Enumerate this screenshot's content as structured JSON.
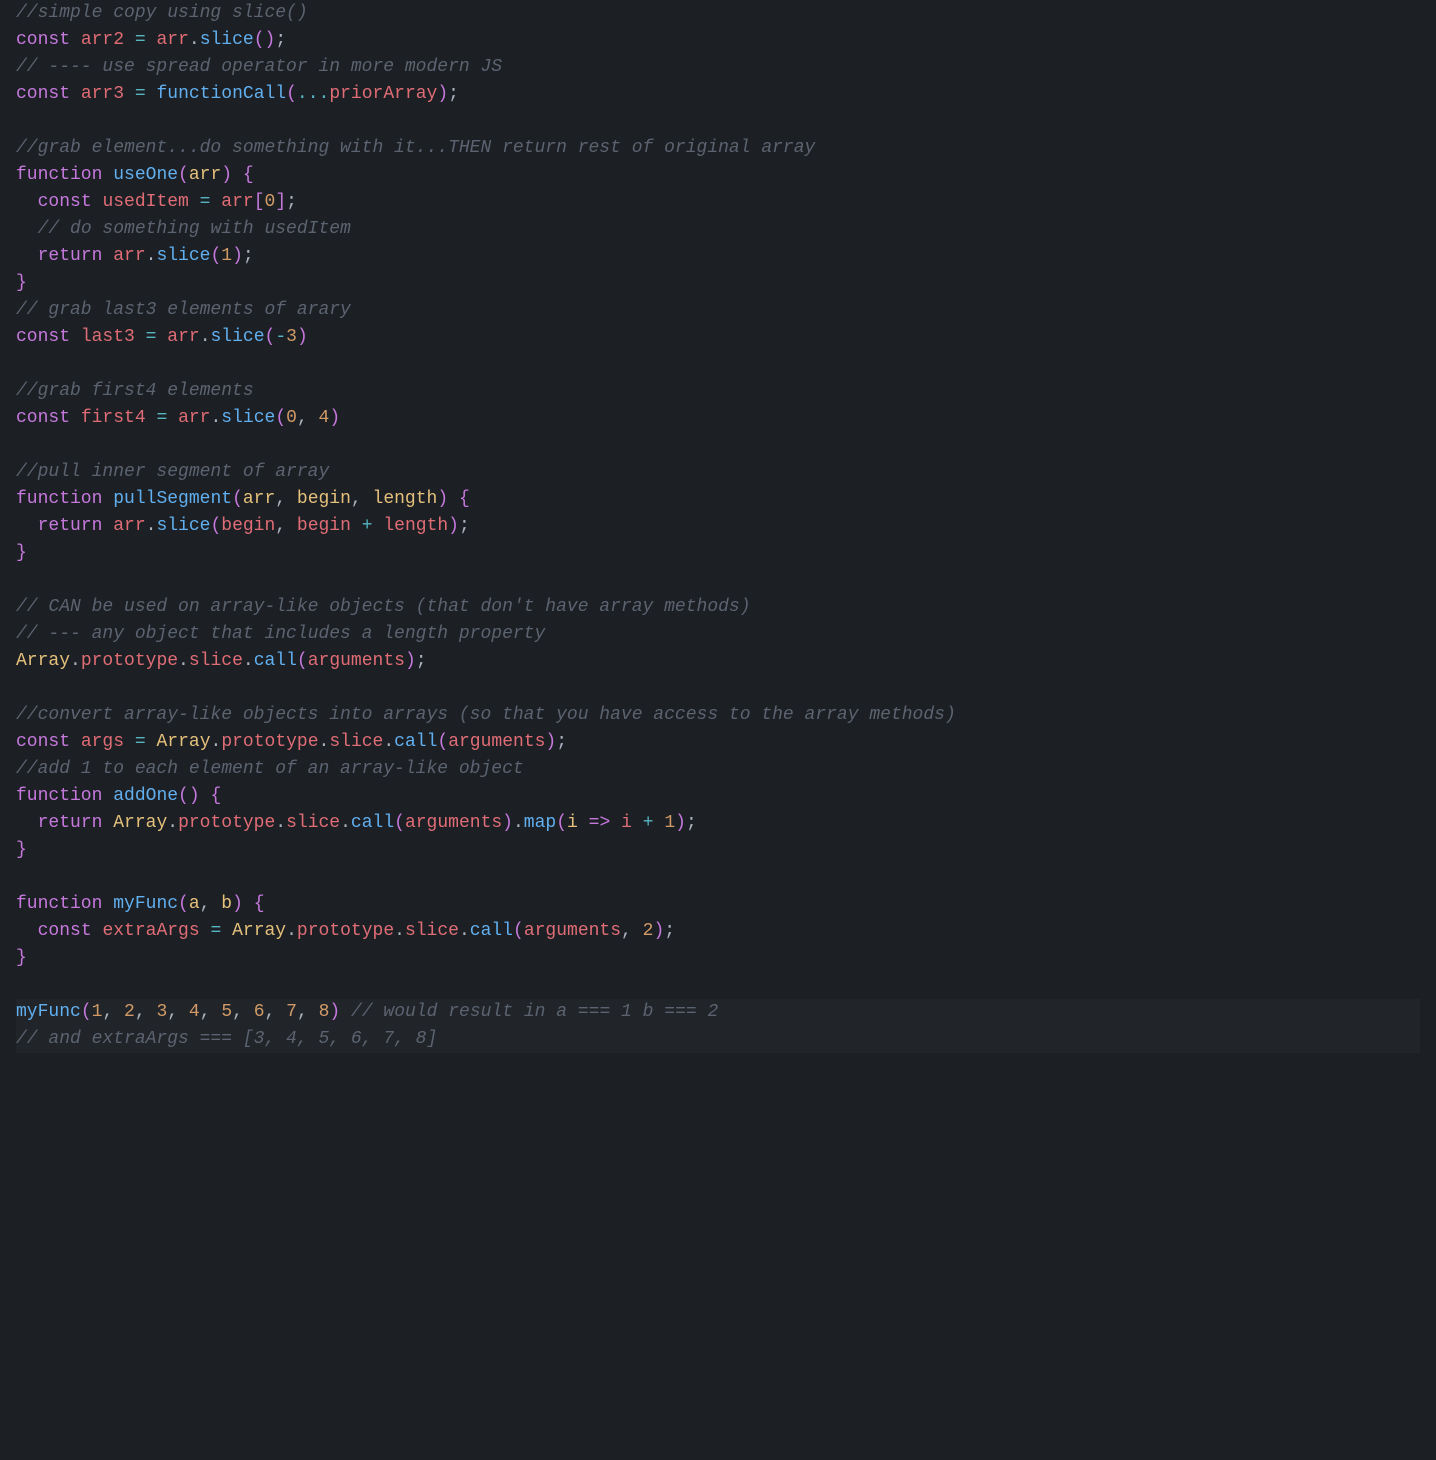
{
  "theme": {
    "bg": "#1c2025",
    "fg": "#abb2bf",
    "comment": "#5c6370",
    "keyword": "#c678dd",
    "varname": "#e06c75",
    "funcname": "#61afef",
    "param": "#e5c07b",
    "op": "#56b6c2",
    "num": "#d19a66",
    "builtin": "#e5c07b"
  },
  "language": "javascript",
  "lines": [
    {
      "n": 1,
      "hl": false,
      "tokens": [
        {
          "c": "comment",
          "t": "//simple copy using slice()"
        }
      ]
    },
    {
      "n": 2,
      "hl": false,
      "tokens": [
        {
          "c": "storage",
          "t": "const"
        },
        {
          "c": "plain",
          "t": " "
        },
        {
          "c": "varname",
          "t": "arr2"
        },
        {
          "c": "plain",
          "t": " "
        },
        {
          "c": "op",
          "t": "="
        },
        {
          "c": "plain",
          "t": " "
        },
        {
          "c": "varname",
          "t": "arr"
        },
        {
          "c": "punct",
          "t": "."
        },
        {
          "c": "funccall",
          "t": "slice"
        },
        {
          "c": "paren",
          "t": "()"
        },
        {
          "c": "punct",
          "t": ";"
        }
      ]
    },
    {
      "n": 3,
      "hl": false,
      "tokens": [
        {
          "c": "comment",
          "t": "// ---- use spread operator in more modern JS"
        }
      ]
    },
    {
      "n": 4,
      "hl": false,
      "tokens": [
        {
          "c": "storage",
          "t": "const"
        },
        {
          "c": "plain",
          "t": " "
        },
        {
          "c": "varname",
          "t": "arr3"
        },
        {
          "c": "plain",
          "t": " "
        },
        {
          "c": "op",
          "t": "="
        },
        {
          "c": "plain",
          "t": " "
        },
        {
          "c": "funccall",
          "t": "functionCall"
        },
        {
          "c": "paren",
          "t": "("
        },
        {
          "c": "op",
          "t": "..."
        },
        {
          "c": "varname",
          "t": "priorArray"
        },
        {
          "c": "paren",
          "t": ")"
        },
        {
          "c": "punct",
          "t": ";"
        }
      ]
    },
    {
      "n": 5,
      "hl": false,
      "tokens": []
    },
    {
      "n": 6,
      "hl": false,
      "tokens": [
        {
          "c": "comment",
          "t": "//grab element...do something with it...THEN return rest of original array"
        }
      ]
    },
    {
      "n": 7,
      "hl": false,
      "tokens": [
        {
          "c": "storage",
          "t": "function"
        },
        {
          "c": "plain",
          "t": " "
        },
        {
          "c": "funcname",
          "t": "useOne"
        },
        {
          "c": "paren",
          "t": "("
        },
        {
          "c": "param",
          "t": "arr"
        },
        {
          "c": "paren",
          "t": ")"
        },
        {
          "c": "plain",
          "t": " "
        },
        {
          "c": "brace",
          "t": "{"
        }
      ]
    },
    {
      "n": 8,
      "hl": false,
      "tokens": [
        {
          "c": "indentguide",
          "t": "  "
        },
        {
          "c": "storage",
          "t": "const"
        },
        {
          "c": "plain",
          "t": " "
        },
        {
          "c": "varname",
          "t": "usedItem"
        },
        {
          "c": "plain",
          "t": " "
        },
        {
          "c": "op",
          "t": "="
        },
        {
          "c": "plain",
          "t": " "
        },
        {
          "c": "varname",
          "t": "arr"
        },
        {
          "c": "bracket",
          "t": "["
        },
        {
          "c": "num",
          "t": "0"
        },
        {
          "c": "bracket",
          "t": "]"
        },
        {
          "c": "punct",
          "t": ";"
        }
      ]
    },
    {
      "n": 9,
      "hl": false,
      "tokens": [
        {
          "c": "indentguide",
          "t": "  "
        },
        {
          "c": "comment",
          "t": "// do something with usedItem"
        }
      ]
    },
    {
      "n": 10,
      "hl": false,
      "tokens": [
        {
          "c": "indentguide",
          "t": "  "
        },
        {
          "c": "storage",
          "t": "return"
        },
        {
          "c": "plain",
          "t": " "
        },
        {
          "c": "varname",
          "t": "arr"
        },
        {
          "c": "punct",
          "t": "."
        },
        {
          "c": "funccall",
          "t": "slice"
        },
        {
          "c": "paren",
          "t": "("
        },
        {
          "c": "num",
          "t": "1"
        },
        {
          "c": "paren",
          "t": ")"
        },
        {
          "c": "punct",
          "t": ";"
        }
      ]
    },
    {
      "n": 11,
      "hl": false,
      "tokens": [
        {
          "c": "brace",
          "t": "}"
        }
      ]
    },
    {
      "n": 12,
      "hl": false,
      "tokens": [
        {
          "c": "comment",
          "t": "// grab last3 elements of arary"
        }
      ]
    },
    {
      "n": 13,
      "hl": false,
      "tokens": [
        {
          "c": "storage",
          "t": "const"
        },
        {
          "c": "plain",
          "t": " "
        },
        {
          "c": "varname",
          "t": "last3"
        },
        {
          "c": "plain",
          "t": " "
        },
        {
          "c": "op",
          "t": "="
        },
        {
          "c": "plain",
          "t": " "
        },
        {
          "c": "varname",
          "t": "arr"
        },
        {
          "c": "punct",
          "t": "."
        },
        {
          "c": "funccall",
          "t": "slice"
        },
        {
          "c": "paren",
          "t": "("
        },
        {
          "c": "op",
          "t": "-"
        },
        {
          "c": "num",
          "t": "3"
        },
        {
          "c": "paren",
          "t": ")"
        }
      ]
    },
    {
      "n": 14,
      "hl": false,
      "tokens": []
    },
    {
      "n": 15,
      "hl": false,
      "tokens": [
        {
          "c": "comment",
          "t": "//grab first4 elements"
        }
      ]
    },
    {
      "n": 16,
      "hl": false,
      "tokens": [
        {
          "c": "storage",
          "t": "const"
        },
        {
          "c": "plain",
          "t": " "
        },
        {
          "c": "varname",
          "t": "first4"
        },
        {
          "c": "plain",
          "t": " "
        },
        {
          "c": "op",
          "t": "="
        },
        {
          "c": "plain",
          "t": " "
        },
        {
          "c": "varname",
          "t": "arr"
        },
        {
          "c": "punct",
          "t": "."
        },
        {
          "c": "funccall",
          "t": "slice"
        },
        {
          "c": "paren",
          "t": "("
        },
        {
          "c": "num",
          "t": "0"
        },
        {
          "c": "punct",
          "t": ", "
        },
        {
          "c": "num",
          "t": "4"
        },
        {
          "c": "paren",
          "t": ")"
        }
      ]
    },
    {
      "n": 17,
      "hl": false,
      "tokens": []
    },
    {
      "n": 18,
      "hl": false,
      "tokens": [
        {
          "c": "comment",
          "t": "//pull inner segment of array"
        }
      ]
    },
    {
      "n": 19,
      "hl": false,
      "tokens": [
        {
          "c": "storage",
          "t": "function"
        },
        {
          "c": "plain",
          "t": " "
        },
        {
          "c": "funcname",
          "t": "pullSegment"
        },
        {
          "c": "paren",
          "t": "("
        },
        {
          "c": "param",
          "t": "arr"
        },
        {
          "c": "punct",
          "t": ", "
        },
        {
          "c": "param",
          "t": "begin"
        },
        {
          "c": "punct",
          "t": ", "
        },
        {
          "c": "param",
          "t": "length"
        },
        {
          "c": "paren",
          "t": ")"
        },
        {
          "c": "plain",
          "t": " "
        },
        {
          "c": "brace",
          "t": "{"
        }
      ]
    },
    {
      "n": 20,
      "hl": false,
      "tokens": [
        {
          "c": "indentguide",
          "t": "  "
        },
        {
          "c": "storage",
          "t": "return"
        },
        {
          "c": "plain",
          "t": " "
        },
        {
          "c": "varname",
          "t": "arr"
        },
        {
          "c": "punct",
          "t": "."
        },
        {
          "c": "funccall",
          "t": "slice"
        },
        {
          "c": "paren",
          "t": "("
        },
        {
          "c": "varname",
          "t": "begin"
        },
        {
          "c": "punct",
          "t": ", "
        },
        {
          "c": "varname",
          "t": "begin"
        },
        {
          "c": "plain",
          "t": " "
        },
        {
          "c": "op",
          "t": "+"
        },
        {
          "c": "plain",
          "t": " "
        },
        {
          "c": "varname",
          "t": "length"
        },
        {
          "c": "paren",
          "t": ")"
        },
        {
          "c": "punct",
          "t": ";"
        }
      ]
    },
    {
      "n": 21,
      "hl": false,
      "tokens": [
        {
          "c": "brace",
          "t": "}"
        }
      ]
    },
    {
      "n": 22,
      "hl": false,
      "tokens": []
    },
    {
      "n": 23,
      "hl": false,
      "tokens": [
        {
          "c": "comment",
          "t": "// CAN be used on array-like objects (that don't have array methods)"
        }
      ]
    },
    {
      "n": 24,
      "hl": false,
      "tokens": [
        {
          "c": "comment",
          "t": "// --- any object that includes a length property"
        }
      ]
    },
    {
      "n": 25,
      "hl": false,
      "tokens": [
        {
          "c": "builtin",
          "t": "Array"
        },
        {
          "c": "punct",
          "t": "."
        },
        {
          "c": "prop",
          "t": "prototype"
        },
        {
          "c": "punct",
          "t": "."
        },
        {
          "c": "prop",
          "t": "slice"
        },
        {
          "c": "punct",
          "t": "."
        },
        {
          "c": "funccall",
          "t": "call"
        },
        {
          "c": "paren",
          "t": "("
        },
        {
          "c": "varname",
          "t": "arguments"
        },
        {
          "c": "paren",
          "t": ")"
        },
        {
          "c": "punct",
          "t": ";"
        }
      ]
    },
    {
      "n": 26,
      "hl": false,
      "tokens": []
    },
    {
      "n": 27,
      "hl": false,
      "tokens": [
        {
          "c": "comment",
          "t": "//convert array-like objects into arrays (so that you have access to the array methods)"
        }
      ]
    },
    {
      "n": 28,
      "hl": false,
      "tokens": [
        {
          "c": "storage",
          "t": "const"
        },
        {
          "c": "plain",
          "t": " "
        },
        {
          "c": "varname",
          "t": "args"
        },
        {
          "c": "plain",
          "t": " "
        },
        {
          "c": "op",
          "t": "="
        },
        {
          "c": "plain",
          "t": " "
        },
        {
          "c": "builtin",
          "t": "Array"
        },
        {
          "c": "punct",
          "t": "."
        },
        {
          "c": "prop",
          "t": "prototype"
        },
        {
          "c": "punct",
          "t": "."
        },
        {
          "c": "prop",
          "t": "slice"
        },
        {
          "c": "punct",
          "t": "."
        },
        {
          "c": "funccall",
          "t": "call"
        },
        {
          "c": "paren",
          "t": "("
        },
        {
          "c": "varname",
          "t": "arguments"
        },
        {
          "c": "paren",
          "t": ")"
        },
        {
          "c": "punct",
          "t": ";"
        }
      ]
    },
    {
      "n": 29,
      "hl": false,
      "tokens": [
        {
          "c": "comment",
          "t": "//add 1 to each element of an array-like object"
        }
      ]
    },
    {
      "n": 30,
      "hl": false,
      "tokens": [
        {
          "c": "storage",
          "t": "function"
        },
        {
          "c": "plain",
          "t": " "
        },
        {
          "c": "funcname",
          "t": "addOne"
        },
        {
          "c": "paren",
          "t": "()"
        },
        {
          "c": "plain",
          "t": " "
        },
        {
          "c": "brace",
          "t": "{"
        }
      ]
    },
    {
      "n": 31,
      "hl": false,
      "tokens": [
        {
          "c": "indentguide",
          "t": "  "
        },
        {
          "c": "storage",
          "t": "return"
        },
        {
          "c": "plain",
          "t": " "
        },
        {
          "c": "builtin",
          "t": "Array"
        },
        {
          "c": "punct",
          "t": "."
        },
        {
          "c": "prop",
          "t": "prototype"
        },
        {
          "c": "punct",
          "t": "."
        },
        {
          "c": "prop",
          "t": "slice"
        },
        {
          "c": "punct",
          "t": "."
        },
        {
          "c": "funccall",
          "t": "call"
        },
        {
          "c": "paren",
          "t": "("
        },
        {
          "c": "varname",
          "t": "arguments"
        },
        {
          "c": "paren",
          "t": ")"
        },
        {
          "c": "punct",
          "t": "."
        },
        {
          "c": "funccall",
          "t": "map"
        },
        {
          "c": "paren",
          "t": "("
        },
        {
          "c": "param",
          "t": "i"
        },
        {
          "c": "plain",
          "t": " "
        },
        {
          "c": "storage",
          "t": "=>"
        },
        {
          "c": "plain",
          "t": " "
        },
        {
          "c": "varname",
          "t": "i"
        },
        {
          "c": "plain",
          "t": " "
        },
        {
          "c": "op",
          "t": "+"
        },
        {
          "c": "plain",
          "t": " "
        },
        {
          "c": "num",
          "t": "1"
        },
        {
          "c": "paren",
          "t": ")"
        },
        {
          "c": "punct",
          "t": ";"
        }
      ]
    },
    {
      "n": 32,
      "hl": false,
      "tokens": [
        {
          "c": "brace",
          "t": "}"
        }
      ]
    },
    {
      "n": 33,
      "hl": false,
      "tokens": []
    },
    {
      "n": 34,
      "hl": false,
      "tokens": [
        {
          "c": "storage",
          "t": "function"
        },
        {
          "c": "plain",
          "t": " "
        },
        {
          "c": "funcname",
          "t": "myFunc"
        },
        {
          "c": "paren",
          "t": "("
        },
        {
          "c": "param",
          "t": "a"
        },
        {
          "c": "punct",
          "t": ", "
        },
        {
          "c": "param",
          "t": "b"
        },
        {
          "c": "paren",
          "t": ")"
        },
        {
          "c": "plain",
          "t": " "
        },
        {
          "c": "brace",
          "t": "{"
        }
      ]
    },
    {
      "n": 35,
      "hl": false,
      "tokens": [
        {
          "c": "indentguide",
          "t": "  "
        },
        {
          "c": "storage",
          "t": "const"
        },
        {
          "c": "plain",
          "t": " "
        },
        {
          "c": "varname",
          "t": "extraArgs"
        },
        {
          "c": "plain",
          "t": " "
        },
        {
          "c": "op",
          "t": "="
        },
        {
          "c": "plain",
          "t": " "
        },
        {
          "c": "builtin",
          "t": "Array"
        },
        {
          "c": "punct",
          "t": "."
        },
        {
          "c": "prop",
          "t": "prototype"
        },
        {
          "c": "punct",
          "t": "."
        },
        {
          "c": "prop",
          "t": "slice"
        },
        {
          "c": "punct",
          "t": "."
        },
        {
          "c": "funccall",
          "t": "call"
        },
        {
          "c": "paren",
          "t": "("
        },
        {
          "c": "varname",
          "t": "arguments"
        },
        {
          "c": "punct",
          "t": ", "
        },
        {
          "c": "num",
          "t": "2"
        },
        {
          "c": "paren",
          "t": ")"
        },
        {
          "c": "punct",
          "t": ";"
        }
      ]
    },
    {
      "n": 36,
      "hl": false,
      "tokens": [
        {
          "c": "brace",
          "t": "}"
        }
      ]
    },
    {
      "n": 37,
      "hl": false,
      "tokens": []
    },
    {
      "n": 38,
      "hl": true,
      "tokens": [
        {
          "c": "funccall",
          "t": "myFunc"
        },
        {
          "c": "paren",
          "t": "("
        },
        {
          "c": "num",
          "t": "1"
        },
        {
          "c": "punct",
          "t": ", "
        },
        {
          "c": "num",
          "t": "2"
        },
        {
          "c": "punct",
          "t": ", "
        },
        {
          "c": "num",
          "t": "3"
        },
        {
          "c": "punct",
          "t": ", "
        },
        {
          "c": "num",
          "t": "4"
        },
        {
          "c": "punct",
          "t": ", "
        },
        {
          "c": "num",
          "t": "5"
        },
        {
          "c": "punct",
          "t": ", "
        },
        {
          "c": "num",
          "t": "6"
        },
        {
          "c": "punct",
          "t": ", "
        },
        {
          "c": "num",
          "t": "7"
        },
        {
          "c": "punct",
          "t": ", "
        },
        {
          "c": "num",
          "t": "8"
        },
        {
          "c": "paren",
          "t": ")"
        },
        {
          "c": "plain",
          "t": " "
        },
        {
          "c": "comment",
          "t": "// would result in a === 1 b === 2"
        }
      ]
    },
    {
      "n": 39,
      "hl": true,
      "tokens": [
        {
          "c": "comment",
          "t": "// and extraArgs === [3, 4, 5, 6, 7, 8]"
        }
      ]
    }
  ]
}
